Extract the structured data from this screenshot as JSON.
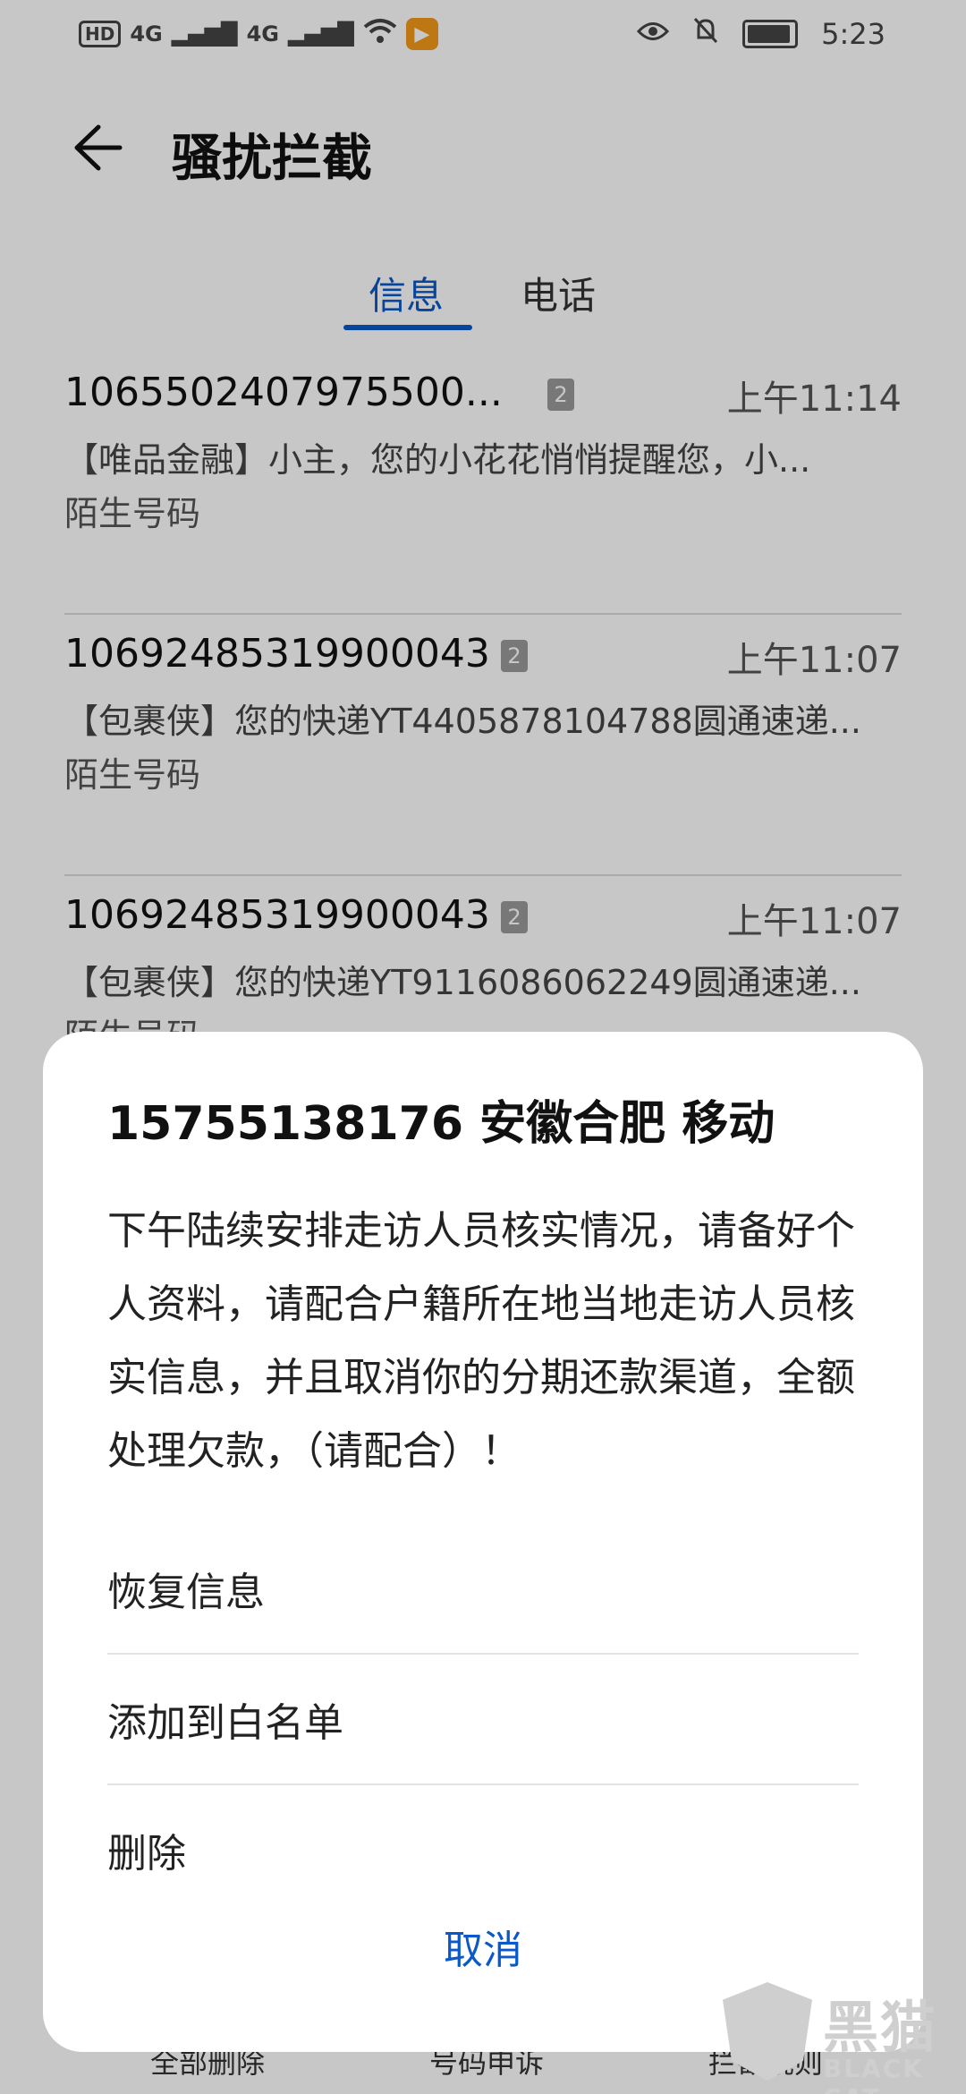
{
  "status_bar": {
    "left_icons": [
      "hd-icon",
      "signal-4g-icon",
      "signal-4g-icon",
      "wifi-icon",
      "video-app-icon"
    ],
    "right_icons": [
      "eye-icon",
      "mute-bell-icon",
      "battery-icon"
    ],
    "hd_label": "HD",
    "network_1": "4G",
    "network_2": "4G",
    "time": "5:23"
  },
  "header": {
    "title": "骚扰拦截"
  },
  "tabs": [
    {
      "label": "信息",
      "active": true
    },
    {
      "label": "电话",
      "active": false
    }
  ],
  "messages": [
    {
      "number": "1065502407975500...",
      "sim": "2",
      "time": "上午11:14",
      "preview": "【唯品金融】小主，您的小花花悄悄提醒您，小...",
      "tag": "陌生号码"
    },
    {
      "number": "10692485319900043",
      "sim": "2",
      "time": "上午11:07",
      "preview": "【包裹侠】您的快递YT4405878104788圆通速递...",
      "tag": "陌生号码"
    },
    {
      "number": "10692485319900043",
      "sim": "2",
      "time": "上午11:07",
      "preview": "【包裹侠】您的快递YT9116086062249圆通速递...",
      "tag": "陌生号码"
    }
  ],
  "bottom_bar": {
    "delete_all": "全部删除",
    "appeal": "号码申诉",
    "rules": "拦截规则"
  },
  "dialog": {
    "title": "15755138176 安徽合肥 移动",
    "body": "下午陆续安排走访人员核实情况，请备好个人资料，请配合户籍所在地当地走访人员核实信息，并且取消你的分期还款渠道，全额处理欠款，（请配合）！",
    "actions": [
      "恢复信息",
      "添加到白名单",
      "删除"
    ],
    "cancel": "取消"
  },
  "watermark": {
    "cn": "黑猫",
    "en": "BLACK CAT"
  },
  "colors": {
    "accent": "#0a59c7",
    "scrim": "rgba(0,0,0,0.22)"
  }
}
